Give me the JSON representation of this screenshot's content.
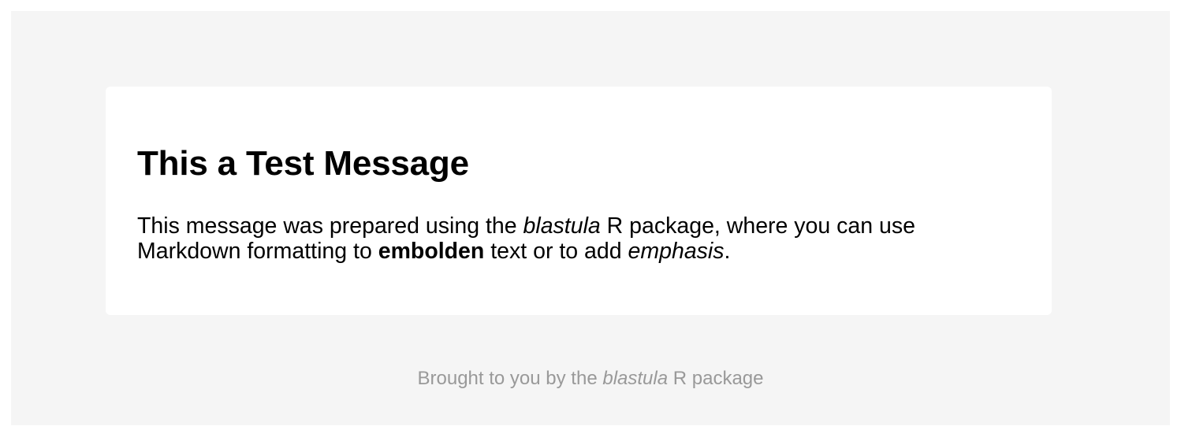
{
  "message": {
    "title": "This a Test Message",
    "body": {
      "part1": "This message was prepared using the ",
      "pkg_italic": "blastula",
      "part2": " R package, where you can use Markdown formatting to ",
      "bold_word": "embolden",
      "part3": " text or to add ",
      "italic_word": "emphasis",
      "part4": "."
    }
  },
  "footer": {
    "prefix": "Brought to you by the ",
    "pkg_italic": "blastula",
    "suffix": " R package"
  },
  "colors": {
    "page_background": "#f5f5f5",
    "card_background": "#ffffff",
    "text": "#000000",
    "footer_text": "#999999"
  }
}
